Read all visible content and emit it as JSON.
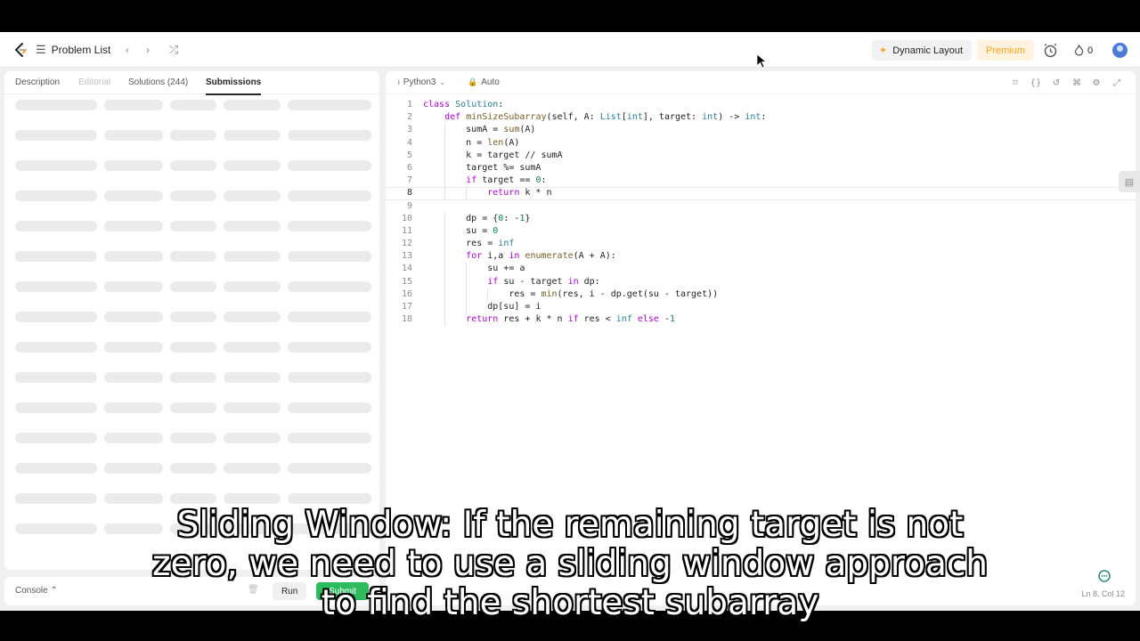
{
  "topnav": {
    "problem_list_label": "Problem List",
    "prev_icon": "chevron-left-icon",
    "next_icon": "chevron-right-icon",
    "shuffle_icon": "shuffle-icon",
    "dynamic_layout_label": "Dynamic Layout",
    "premium_label": "Premium",
    "streak_count": "0",
    "brand_color": "#ffa116"
  },
  "left_tabs": [
    {
      "label": "Description",
      "state": "normal"
    },
    {
      "label": "Editorial",
      "state": "disabled"
    },
    {
      "label": "Solutions (244)",
      "state": "normal"
    },
    {
      "label": "Submissions",
      "state": "active"
    }
  ],
  "console": {
    "label": "Console",
    "run_label": "Run",
    "submit_label": "Submit",
    "submit_color": "#2cbb5d"
  },
  "editor": {
    "language": "Python3",
    "mode": "Auto",
    "status": "Ln 8, Col 12",
    "current_line": 8,
    "lines": [
      "class Solution:",
      "    def minSizeSubarray(self, A: List[int], target: int) -> int:",
      "        sumA = sum(A)",
      "        n = len(A)",
      "        k = target // sumA",
      "        target %= sumA",
      "        if target == 0:",
      "            return k * n",
      "",
      "        dp = {0: -1}",
      "        su = 0",
      "        res = inf",
      "        for i,a in enumerate(A + A):",
      "            su += a",
      "            if su - target in dp:",
      "                res = min(res, i - dp.get(su - target))",
      "            dp[su] = i",
      "        return res + k * n if res < inf else -1"
    ]
  },
  "subtitle": {
    "lines": [
      "Sliding Window: If the remaining target is not",
      "zero, we need to use a sliding window approach",
      "to find the shortest subarray"
    ]
  }
}
